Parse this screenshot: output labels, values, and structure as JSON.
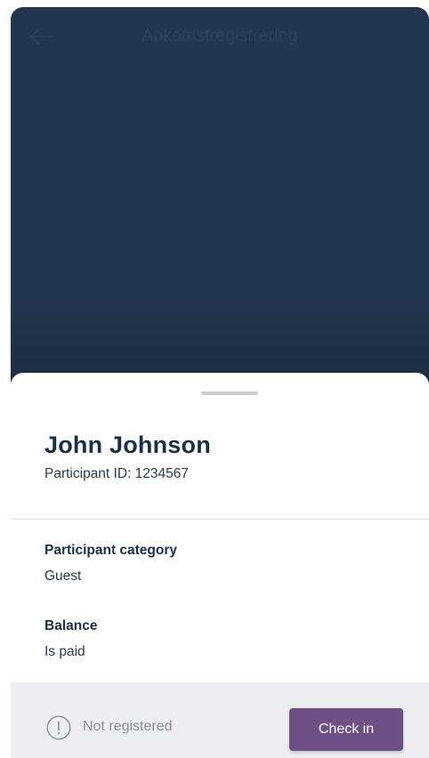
{
  "header": {
    "title": "Ankomstregistrering",
    "back_icon": "arrow-left-icon"
  },
  "participant": {
    "name": "John Johnson",
    "id_text": "Participant ID: 1234567"
  },
  "details": [
    {
      "label": "Participant category",
      "value": "Guest"
    },
    {
      "label": "Balance",
      "value": "Is paid"
    }
  ],
  "footer": {
    "status_icon": "exclamation-circle-icon",
    "status_text": "Not registered",
    "checkin_label": "Check in"
  },
  "colors": {
    "backdrop": "#23364f",
    "title_text": "#2b4361",
    "accent_button": "#6e4f86",
    "footer_bg": "#eceef2",
    "muted_text": "#8a919b"
  }
}
